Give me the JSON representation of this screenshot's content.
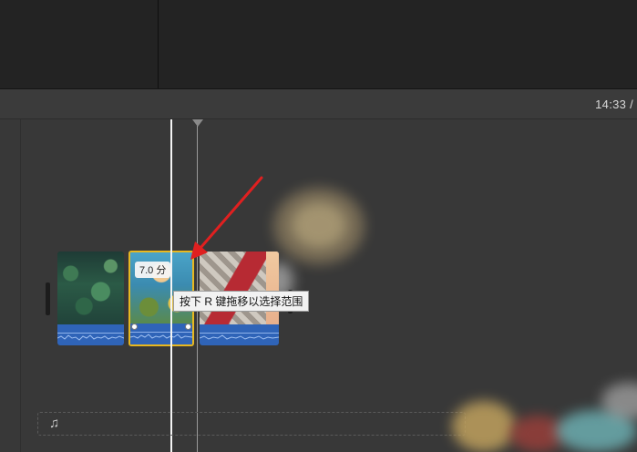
{
  "header": {
    "timecode": "14:33 /"
  },
  "timeline": {
    "clips": [
      {
        "name": "clip-1",
        "selected": false
      },
      {
        "name": "clip-2",
        "selected": true,
        "duration_label": "7.0 分"
      },
      {
        "name": "clip-3",
        "selected": false
      }
    ],
    "tooltip": "按下 R 键拖移以选择范围",
    "music_glyph": "♫"
  },
  "colors": {
    "selection": "#e8b820",
    "audio": "#2f64b8",
    "arrow": "#e02020"
  },
  "icons": {
    "music": "music-note-icon"
  }
}
